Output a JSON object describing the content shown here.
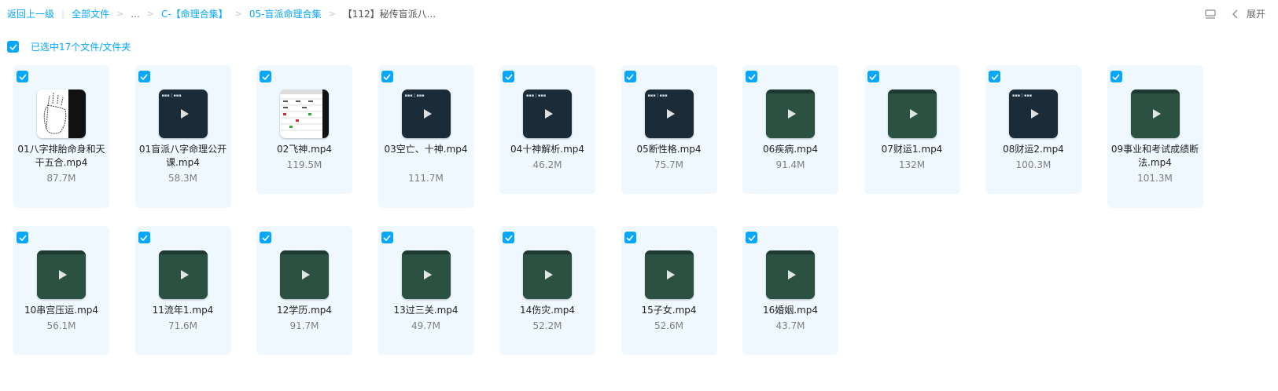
{
  "breadcrumb": {
    "back": "返回上一级",
    "divider": "|",
    "items": [
      "全部文件",
      "...",
      "C-【命理合集】",
      "05-盲派命理合集",
      "【112】秘传盲派八..."
    ]
  },
  "toolbar": {
    "expand_label": "展开",
    "icons": [
      "list-view-icon",
      "chevron-left-icon"
    ]
  },
  "selection": {
    "label": "已选中17个文件/文件夹",
    "checked": true
  },
  "colors": {
    "accent": "#06a7ff",
    "card_bg": "#eef8fe",
    "video_dark": "#1c2b38",
    "video_green": "#234538"
  },
  "files": [
    {
      "name": "01八字排胎命身和天干五合.mp4",
      "size": "87.7M",
      "thumb": "doc-hand"
    },
    {
      "name": "01盲派八字命理公开课.mp4",
      "size": "58.3M",
      "thumb": "dark"
    },
    {
      "name": "02飞神.mp4",
      "size": "119.5M",
      "thumb": "doc-table"
    },
    {
      "name": "03空亡、十神.mp4",
      "size": "111.7M",
      "thumb": "dark"
    },
    {
      "name": "04十神解析.mp4",
      "size": "46.2M",
      "thumb": "dark"
    },
    {
      "name": "05断性格.mp4",
      "size": "75.7M",
      "thumb": "dark"
    },
    {
      "name": "06疾病.mp4",
      "size": "91.4M",
      "thumb": "green"
    },
    {
      "name": "07财运1.mp4",
      "size": "132M",
      "thumb": "green"
    },
    {
      "name": "08财运2.mp4",
      "size": "100.3M",
      "thumb": "dark"
    },
    {
      "name": "09事业和考试成绩断法.mp4",
      "size": "101.3M",
      "thumb": "green"
    },
    {
      "name": "10串宫压运.mp4",
      "size": "56.1M",
      "thumb": "green"
    },
    {
      "name": "11流年1.mp4",
      "size": "71.6M",
      "thumb": "green"
    },
    {
      "name": "12学历.mp4",
      "size": "91.7M",
      "thumb": "green"
    },
    {
      "name": "13过三关.mp4",
      "size": "49.7M",
      "thumb": "green"
    },
    {
      "name": "14伤灾.mp4",
      "size": "52.2M",
      "thumb": "green"
    },
    {
      "name": "15子女.mp4",
      "size": "52.6M",
      "thumb": "green"
    },
    {
      "name": "16婚姻.mp4",
      "size": "43.7M",
      "thumb": "green"
    }
  ]
}
